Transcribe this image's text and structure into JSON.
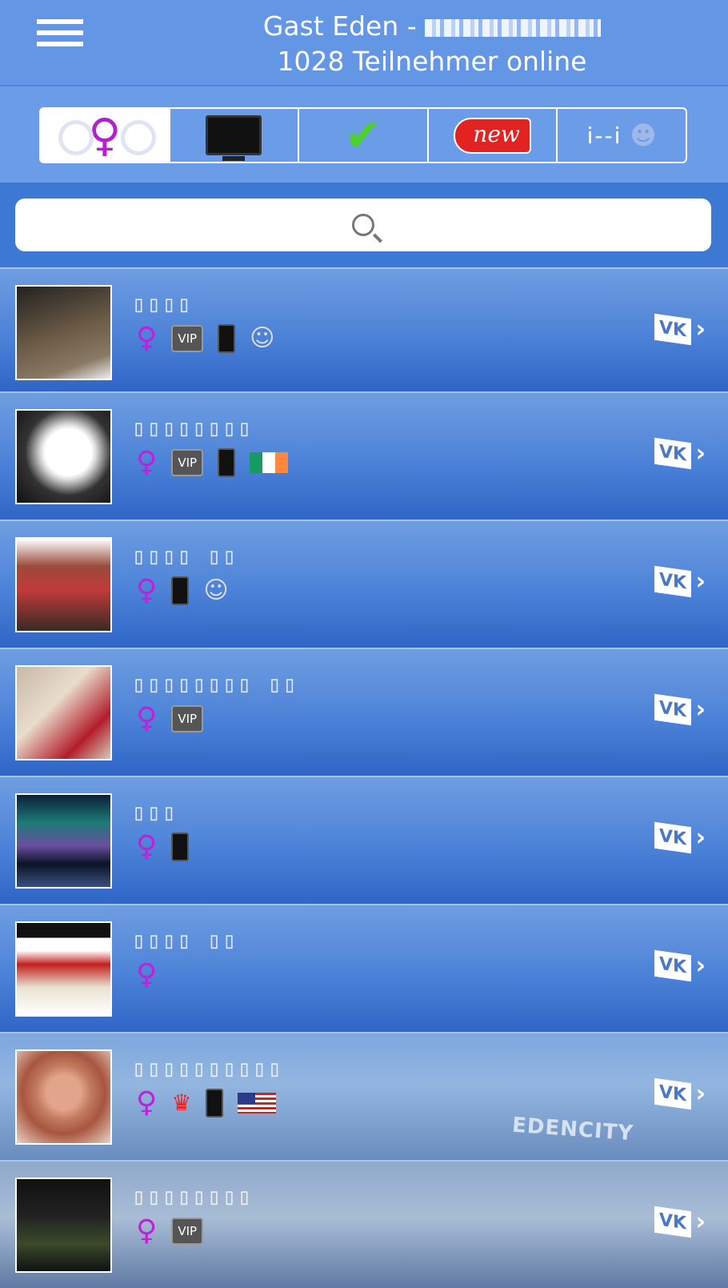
{
  "header": {
    "title": "Gast Eden -",
    "subtitle": "1028 Teilnehmer online"
  },
  "filters": {
    "new_label": "new"
  },
  "search": {
    "placeholder": ""
  },
  "users": [
    {
      "icons": [
        "female",
        "vip",
        "phone",
        "sleep"
      ],
      "flag": ""
    },
    {
      "icons": [
        "female",
        "vip",
        "phone",
        "flag"
      ],
      "flag": "Ireland"
    },
    {
      "icons": [
        "female",
        "phone",
        "sleep"
      ],
      "flag": ""
    },
    {
      "icons": [
        "female",
        "vip"
      ],
      "flag": ""
    },
    {
      "icons": [
        "female",
        "phone"
      ],
      "flag": ""
    },
    {
      "icons": [
        "female"
      ],
      "flag": ""
    },
    {
      "icons": [
        "female",
        "jester",
        "phone",
        "flag"
      ],
      "flag": "USA"
    },
    {
      "icons": [
        "female",
        "vip"
      ],
      "flag": ""
    }
  ],
  "labels": {
    "vip": "VIP",
    "vk": "VK",
    "watermark": "EDENCITY"
  },
  "colors": {
    "header_bg": "#6496e6",
    "row_blue": "#4c82d7",
    "female_symbol": "#c020d8",
    "new_tag": "#e32222"
  }
}
